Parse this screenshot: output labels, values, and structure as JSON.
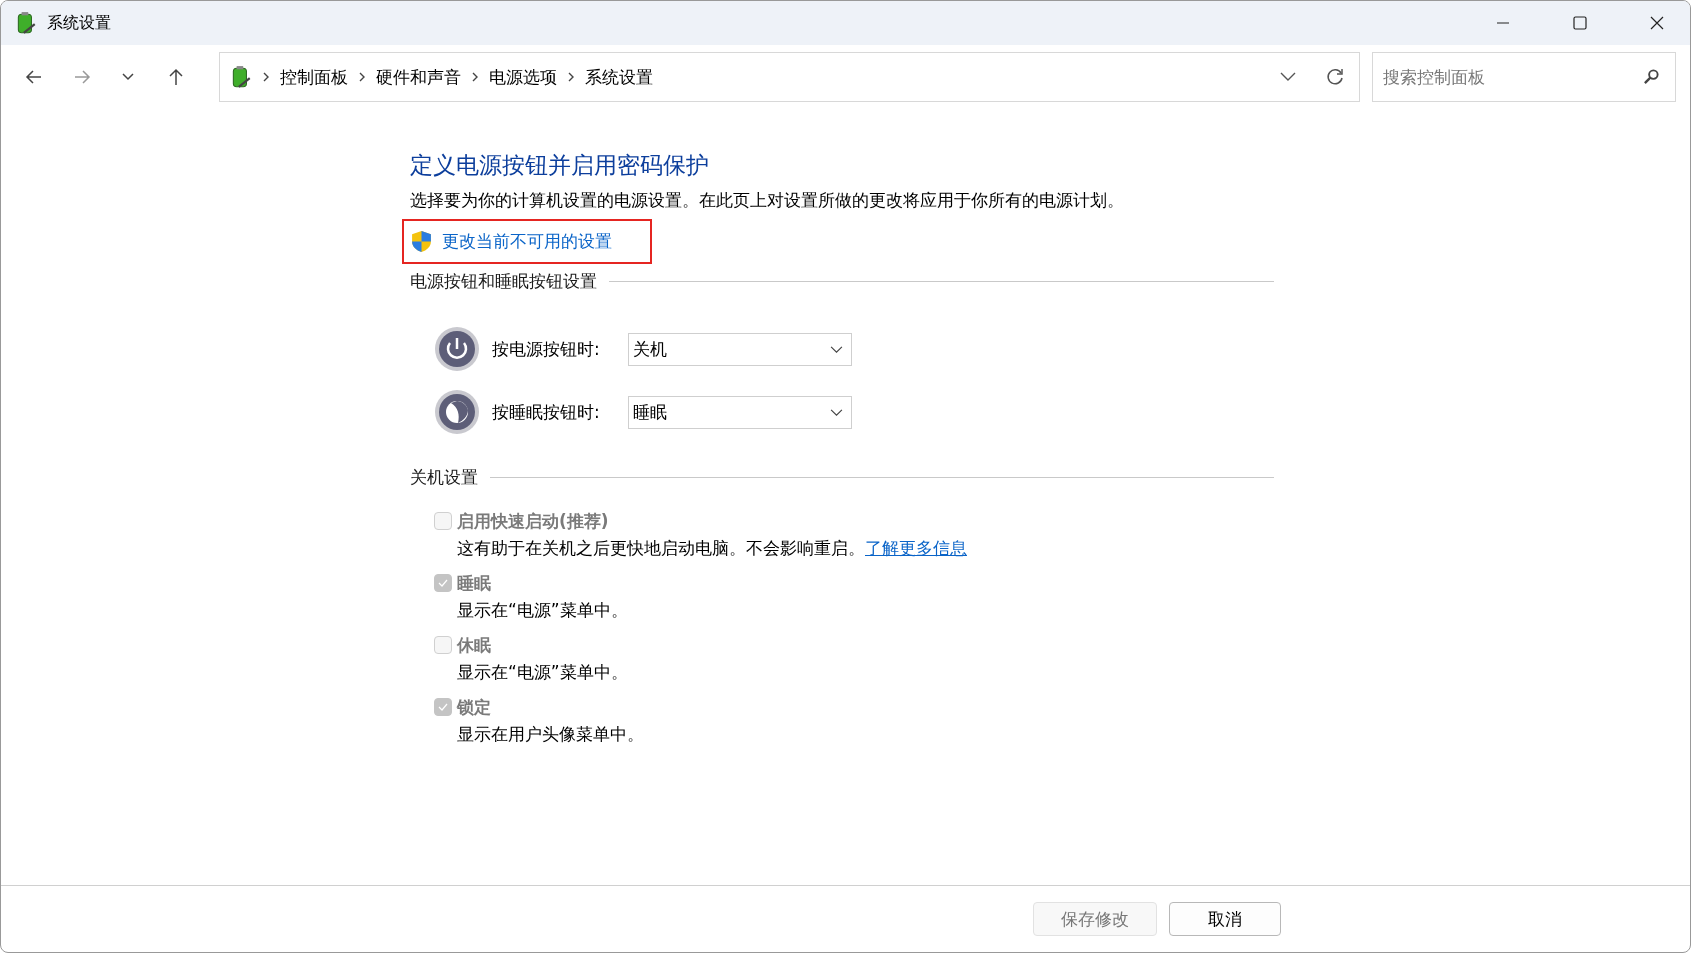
{
  "window": {
    "title": "系统设置"
  },
  "nav": {
    "breadcrumbs": [
      "控制面板",
      "硬件和声音",
      "电源选项",
      "系统设置"
    ],
    "search": {
      "placeholder": "搜索控制面板"
    }
  },
  "heading": "定义电源按钮并启用密码保护",
  "description": "选择要为你的计算机设置的电源设置。在此页上对设置所做的更改将应用于你所有的电源计划。",
  "admin_link": {
    "label": "更改当前不可用的设置",
    "highlighted": true
  },
  "button_section": {
    "title": "电源按钮和睡眠按钮设置",
    "rows": [
      {
        "kind": "power",
        "label": "按电源按钮时:",
        "value": "关机"
      },
      {
        "kind": "sleep",
        "label": "按睡眠按钮时:",
        "value": "睡眠"
      }
    ]
  },
  "shutdown_section": {
    "title": "关机设置",
    "options": [
      {
        "label": "启用快速启动(推荐)",
        "checked": false,
        "disabled": true,
        "description": "这有助于在关机之后更快地启动电脑。不会影响重启。",
        "link": "了解更多信息"
      },
      {
        "label": "睡眠",
        "checked": true,
        "disabled": true,
        "description": "显示在“电源”菜单中。"
      },
      {
        "label": "休眠",
        "checked": false,
        "disabled": true,
        "description": "显示在“电源”菜单中。"
      },
      {
        "label": "锁定",
        "checked": true,
        "disabled": true,
        "description": "显示在用户头像菜单中。"
      }
    ]
  },
  "footer": {
    "buttons": [
      {
        "label": "保存修改",
        "disabled": true
      },
      {
        "label": "取消",
        "disabled": false
      }
    ]
  }
}
